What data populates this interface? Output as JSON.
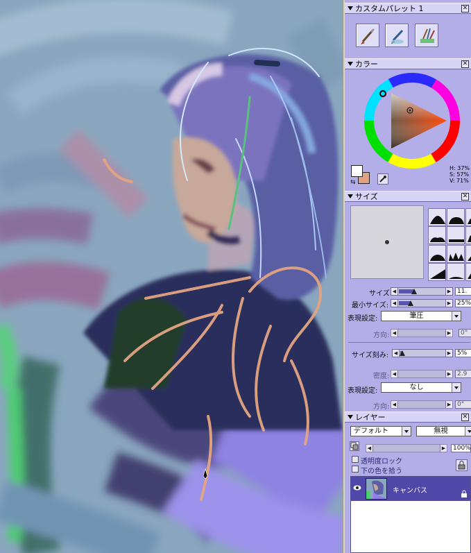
{
  "custom_palette": {
    "title": "カスタムパレット 1",
    "tools": [
      {
        "icon": "brush-tool-icon"
      },
      {
        "icon": "pen-brush-tool-icon"
      },
      {
        "icon": "brush-set-icon"
      }
    ]
  },
  "color": {
    "title": "カラー",
    "main_color": "#ffffff",
    "sub_color": "#e0a283",
    "h_label": "H: 37%",
    "s_label": "S: 57%",
    "v_label": "V: 71%"
  },
  "size": {
    "title": "サイズ",
    "size_label": "サイズ:",
    "size_value": "11.",
    "size_fraction": 0.33,
    "min_size_label": "最小サイズ:",
    "min_size_value": "25%",
    "min_size_fraction": 0.25,
    "expression_label": "表現設定:",
    "expression_value": "筆圧",
    "direction_label": "方向:",
    "direction_value": "0°",
    "size_step_label": "サイズ刻み:",
    "size_step_value": "5%",
    "size_step_fraction": 0.05,
    "density_label": "密度:",
    "density_value": "2.9",
    "expression2_label": "表現設定:",
    "expression2_value": "なし",
    "direction2_label": "方向:",
    "direction2_value": "0°"
  },
  "layer": {
    "title": "レイヤー",
    "preset_value": "デフォルト",
    "blend_value": "無視",
    "opacity_value": "100%",
    "transparency_lock_label": "透明度ロック",
    "pick_under_color_label": "下の色を拾う",
    "layers": [
      {
        "name": "キャンバス",
        "locked": true,
        "visible": true
      }
    ]
  },
  "colors": {
    "panel_bg": "#b3ade8",
    "header_bg": "#d8d4f6",
    "selected_layer": "#4f48a8"
  }
}
